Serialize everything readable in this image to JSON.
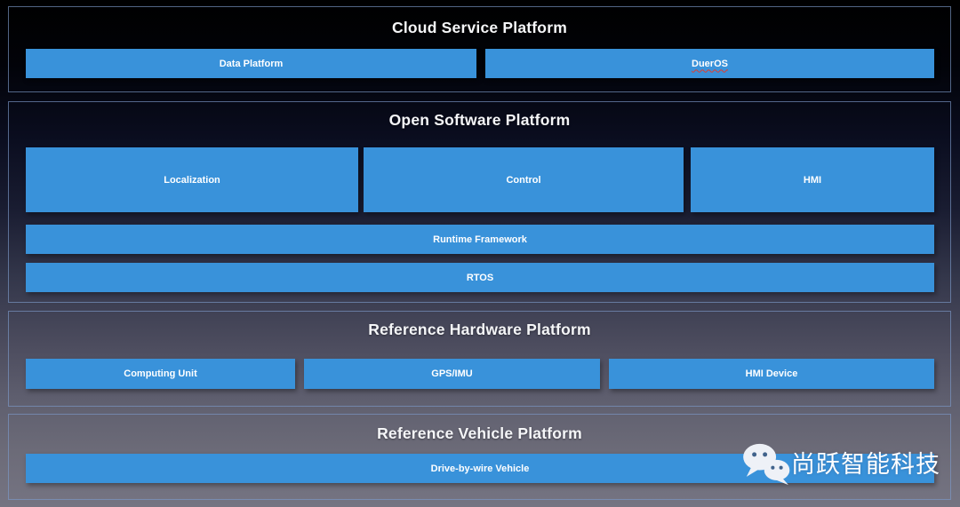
{
  "colors": {
    "bar_blue": "#3992da",
    "bar_text": "#ffffff",
    "title_text": "#f5f6f8",
    "section_border": "rgba(125,153,201,0.65)",
    "dueros_underline": "#e23b2e",
    "page_bg_top": "#000000",
    "page_bg_bottom": "#757482"
  },
  "sections": [
    {
      "title": "Cloud Service Platform",
      "blocks": [
        {
          "label": "Data Platform"
        },
        {
          "label": "DuerOS",
          "spellcheck_squiggle": true
        }
      ]
    },
    {
      "title": "Open Software Platform",
      "blocks": [
        {
          "label": "Localization"
        },
        {
          "label": "Control"
        },
        {
          "label": "HMI"
        },
        {
          "label": "Runtime Framework"
        },
        {
          "label": "RTOS"
        }
      ]
    },
    {
      "title": "Reference Hardware Platform",
      "blocks": [
        {
          "label": "Computing Unit"
        },
        {
          "label": "GPS/IMU"
        },
        {
          "label": "HMI Device"
        }
      ]
    },
    {
      "title": "Reference Vehicle Platform",
      "blocks": [
        {
          "label": "Drive-by-wire Vehicle"
        }
      ]
    }
  ],
  "watermark": {
    "icon": "wechat-icon",
    "text": "尚跃智能科技"
  }
}
